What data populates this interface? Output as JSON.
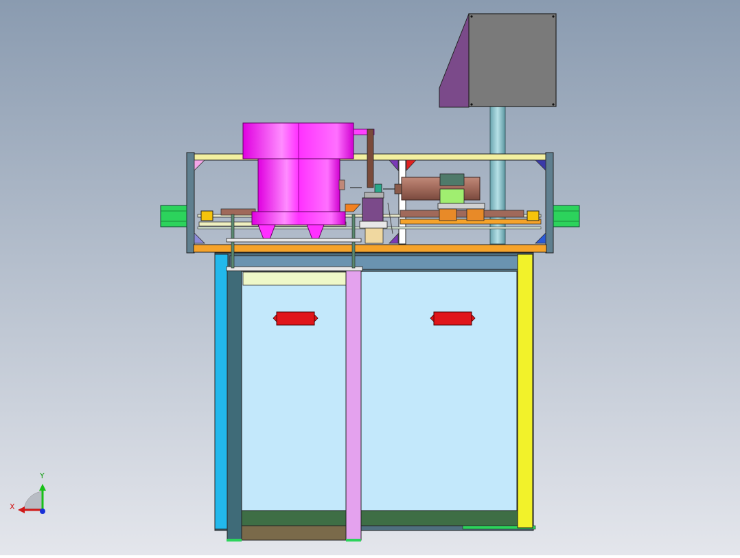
{
  "viewport": {
    "background_top": "#8a9bb0",
    "background_bottom": "#e4e6ec"
  },
  "model": {
    "name": "",
    "parts": {
      "control_box": {
        "front": "#7a7a7a",
        "side": "#7b4a8a"
      },
      "vibratory_bowl": {
        "color": "#ff00ff",
        "highlight": "#ff8cff"
      },
      "motor": {
        "body": "#a0695a",
        "terminal_box": "#4f7a6a",
        "base": "#e88a28"
      },
      "top_frame": {
        "rail": "#f3f0a0",
        "post": "#5f7f8f"
      },
      "side_actuators": {
        "color": "#2cd35c"
      },
      "yellow_sensors": {
        "color": "#f6c40c"
      },
      "base_plate": {
        "color": "#f6a32a"
      },
      "cabinet": {
        "panel": "#c3e8fb",
        "left_post": "#3f6b78",
        "right_post": "#f2f22a",
        "pink_post": "#e4a2ee",
        "cyan_post": "#22b8ec",
        "top_band": "#6a93b0",
        "bottom_band": "#3e6e45"
      },
      "warning_labels": {
        "color": "#e0151a"
      }
    }
  },
  "triad": {
    "x_label": "X",
    "y_label": "Y"
  }
}
